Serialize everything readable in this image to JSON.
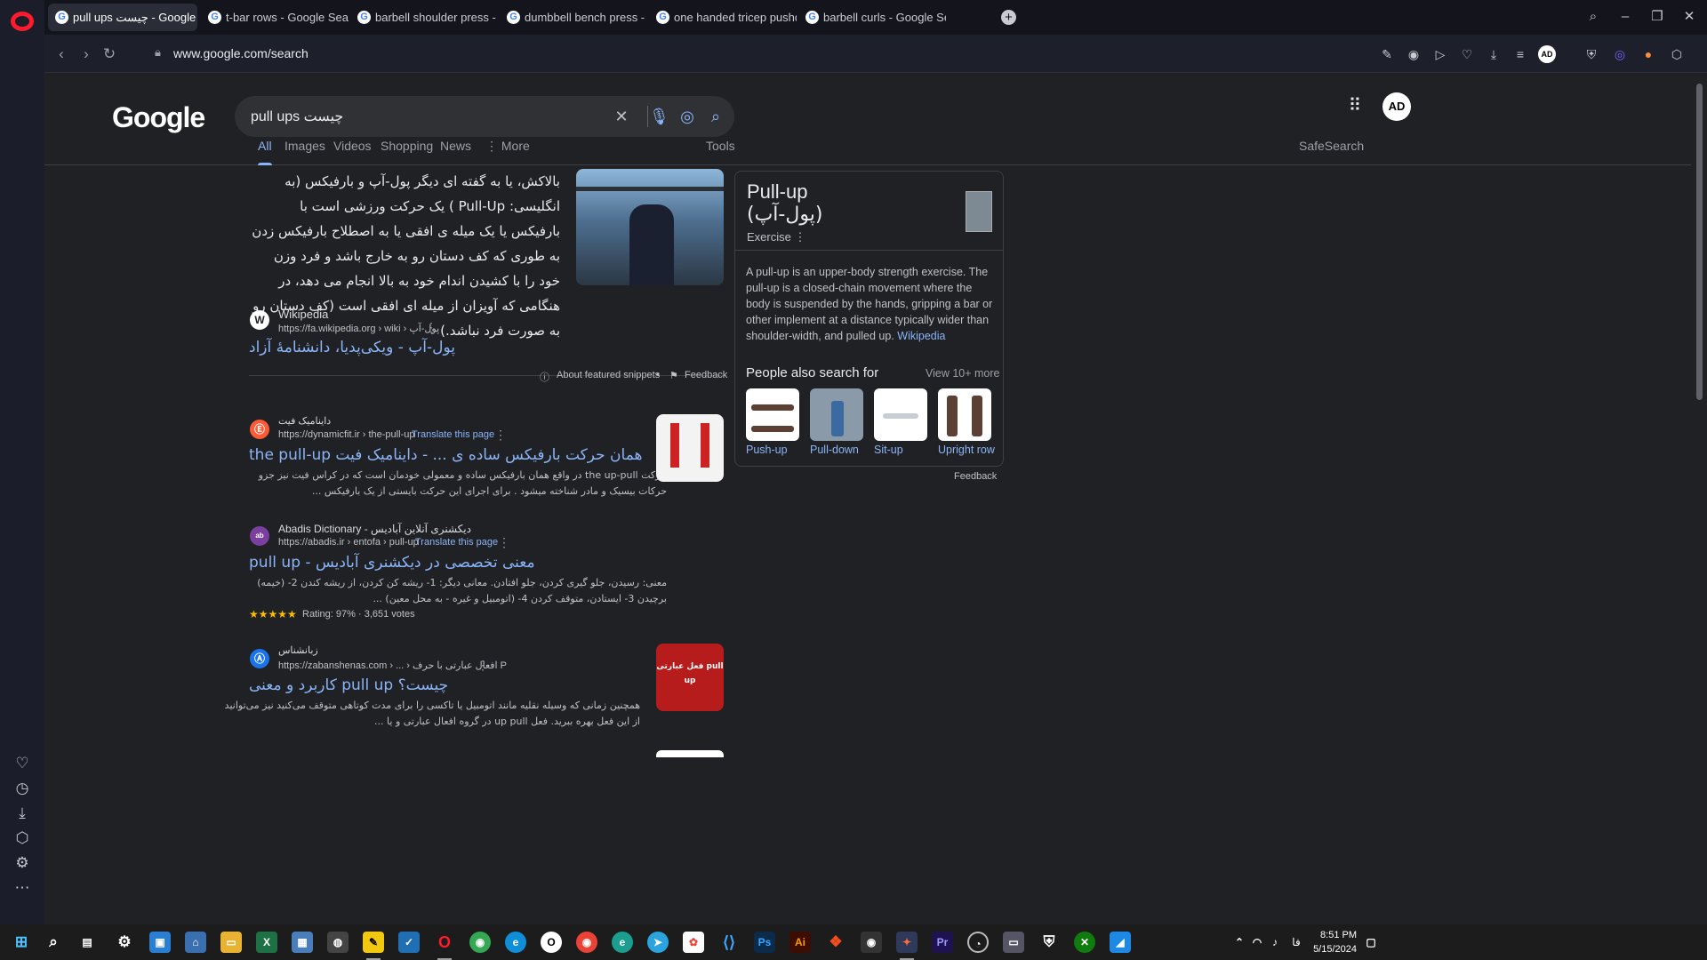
{
  "browser": {
    "tabs": [
      {
        "label": "pull ups چیست - Google S",
        "active": true
      },
      {
        "label": "t-bar rows - Google Search"
      },
      {
        "label": "barbell shoulder press - G"
      },
      {
        "label": "dumbbell bench press - G"
      },
      {
        "label": "one handed tricep pushdo"
      },
      {
        "label": "barbell curls - Google Sea"
      }
    ],
    "url": "www.google.com/search"
  },
  "google": {
    "logo": "Google",
    "query": "pull ups چیست",
    "tabs": [
      "All",
      "Images",
      "Videos",
      "Shopping",
      "News",
      "More"
    ],
    "tools": "Tools",
    "safesearch": "SafeSearch",
    "avatar": "AD"
  },
  "featured": {
    "text": "بالاکش، یا به گفته ای دیگر پول-آپ و بارفیکس (به انگلیسی: Pull-Up ) یک حرکت ورزشی است با بارفیکس یا یک میله ی افقی یا به اصطلاح بارفیکس زدن به طوری که کف دستان رو به خارج باشد و فرد وزن خود را با کشیدن اندام خود به بالا انجام می دهد، در هنگامی که آویزان از میله ای افقی است (کف دستان رو به صورت فرد نباشد.)",
    "source_name": "Wikipedia",
    "source_url": "https://fa.wikipedia.org › wiki › پول-آپ",
    "title": "پول-آپ - ویکی‌پدیا، دانشنامهٔ آزاد",
    "about": "About featured snippets",
    "feedback": "Feedback"
  },
  "results": [
    {
      "site": "داینامیک فیت",
      "url": "https://dynamicfit.ir › the-pull-up",
      "translate": "Translate this page",
      "title": "the pull-up همان حرکت بارفیکس ساده ی ... - داینامیک فیت",
      "desc": "حرکت the up-pull در واقع همان بارفیکس ساده و معمولی خودمان است که در کراس فیت نیز جزو حرکات بیسیک و مادر شناخته میشود . برای اجرای این حرکت بایستی از یک بارفیکس ..."
    },
    {
      "site": "Abadis Dictionary - دیکشنری آنلاین آبادیس",
      "url": "https://abadis.ir › entofa › pull-up",
      "translate": "Translate this page",
      "title": "pull up - معنی تخصصی در دیکشنری آبادیس",
      "desc": "معنی: رسیدن، جلو گیری کردن، جلو افتادن. معانی دیگر: 1- ریشه کن کردن، از ریشه کندن 2- (خیمه) برچیدن 3- ایستادن، متوقف کردن 4- (اتومبیل و غیره - به محل معین) ...",
      "stars": "★★★★★",
      "rating": "Rating: 97% · 3,651 votes"
    },
    {
      "site": "زبانشناس",
      "url": "https://zabanshenas.com › ... › افعال عبارتی با حرف P",
      "title": "کاربرد و معنی pull up چیست؟",
      "desc": "همچنین زمانی که وسیله نقلیه مانند اتومبیل یا تاکسی را برای مدت کوتاهی متوقف می‌کنید نیز می‌توانید از این فعل بهره ببرید. فعل up pull در گروه افعال عبارتی و یا ...",
      "thumb_text": "فعل عبارتی pull up"
    }
  ],
  "knowledge": {
    "title": "Pull-up",
    "subtitle": "(پول-آپ)",
    "type": "Exercise",
    "desc": "A pull-up is an upper-body strength exercise. The pull-up is a closed-chain movement where the body is suspended by the hands, gripping a bar or other implement at a distance typically wider than shoulder-width, and pulled up.",
    "desc_link": "Wikipedia",
    "people_also": "People also search for",
    "view_more": "View 10+ more",
    "related": [
      "Push-up",
      "Pull-down",
      "Sit-up",
      "Upright row"
    ],
    "feedback": "Feedback"
  },
  "taskbar": {
    "time": "8:51 PM",
    "date": "5/15/2024",
    "lang": "فا"
  }
}
